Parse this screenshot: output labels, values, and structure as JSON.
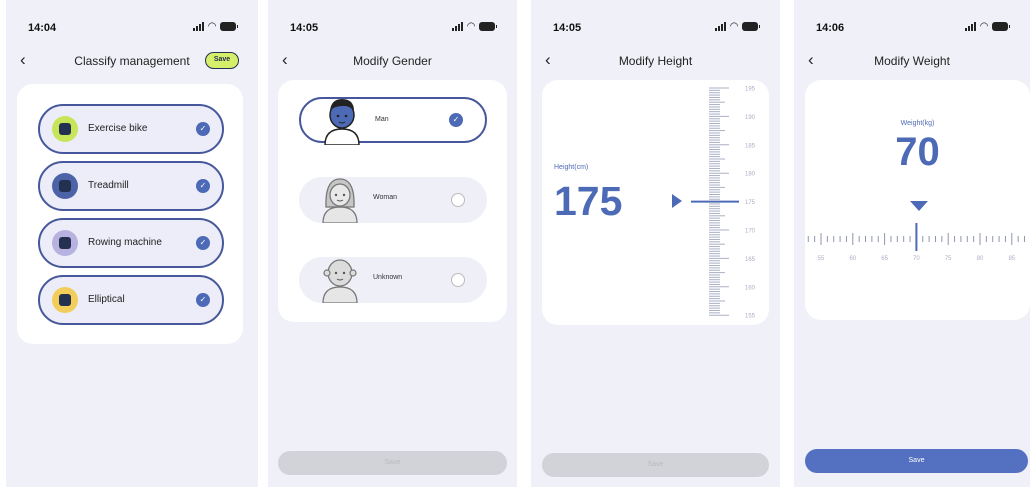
{
  "colors": {
    "accent": "#4d6ab6",
    "outline": "#46589b",
    "save_chip": "#d6ef6b",
    "page_bg": "#f0f1f8"
  },
  "screens": [
    {
      "status_time": "14:04",
      "title": "Classify management",
      "save_label": "Save",
      "categories": [
        {
          "label": "Exercise bike",
          "icon": "exercise-bike-icon",
          "color": "#c8e55a",
          "checked": true
        },
        {
          "label": "Treadmill",
          "icon": "treadmill-icon",
          "color": "#4d63a8",
          "checked": true
        },
        {
          "label": "Rowing machine",
          "icon": "rowing-machine-icon",
          "color": "#b7b2e0",
          "checked": true
        },
        {
          "label": "Elliptical",
          "icon": "elliptical-icon",
          "color": "#f3cd59",
          "checked": true
        }
      ]
    },
    {
      "status_time": "14:05",
      "title": "Modify Gender",
      "options": [
        {
          "label": "Man",
          "selected": true
        },
        {
          "label": "Woman",
          "selected": false
        },
        {
          "label": "Unknown",
          "selected": false
        }
      ],
      "save_label": "Save"
    },
    {
      "status_time": "14:05",
      "title": "Modify Height",
      "field_label": "Height(cm)",
      "value": "175",
      "ruler_labels": [
        "195",
        "190",
        "185",
        "180",
        "175",
        "170",
        "165",
        "160",
        "155"
      ],
      "save_label": "Save"
    },
    {
      "status_time": "14:06",
      "title": "Modify Weight",
      "field_label": "Weight(kg)",
      "value": "70",
      "ruler_labels": [
        "55",
        "60",
        "65",
        "70",
        "75",
        "80",
        "85"
      ],
      "save_label": "Save"
    }
  ]
}
